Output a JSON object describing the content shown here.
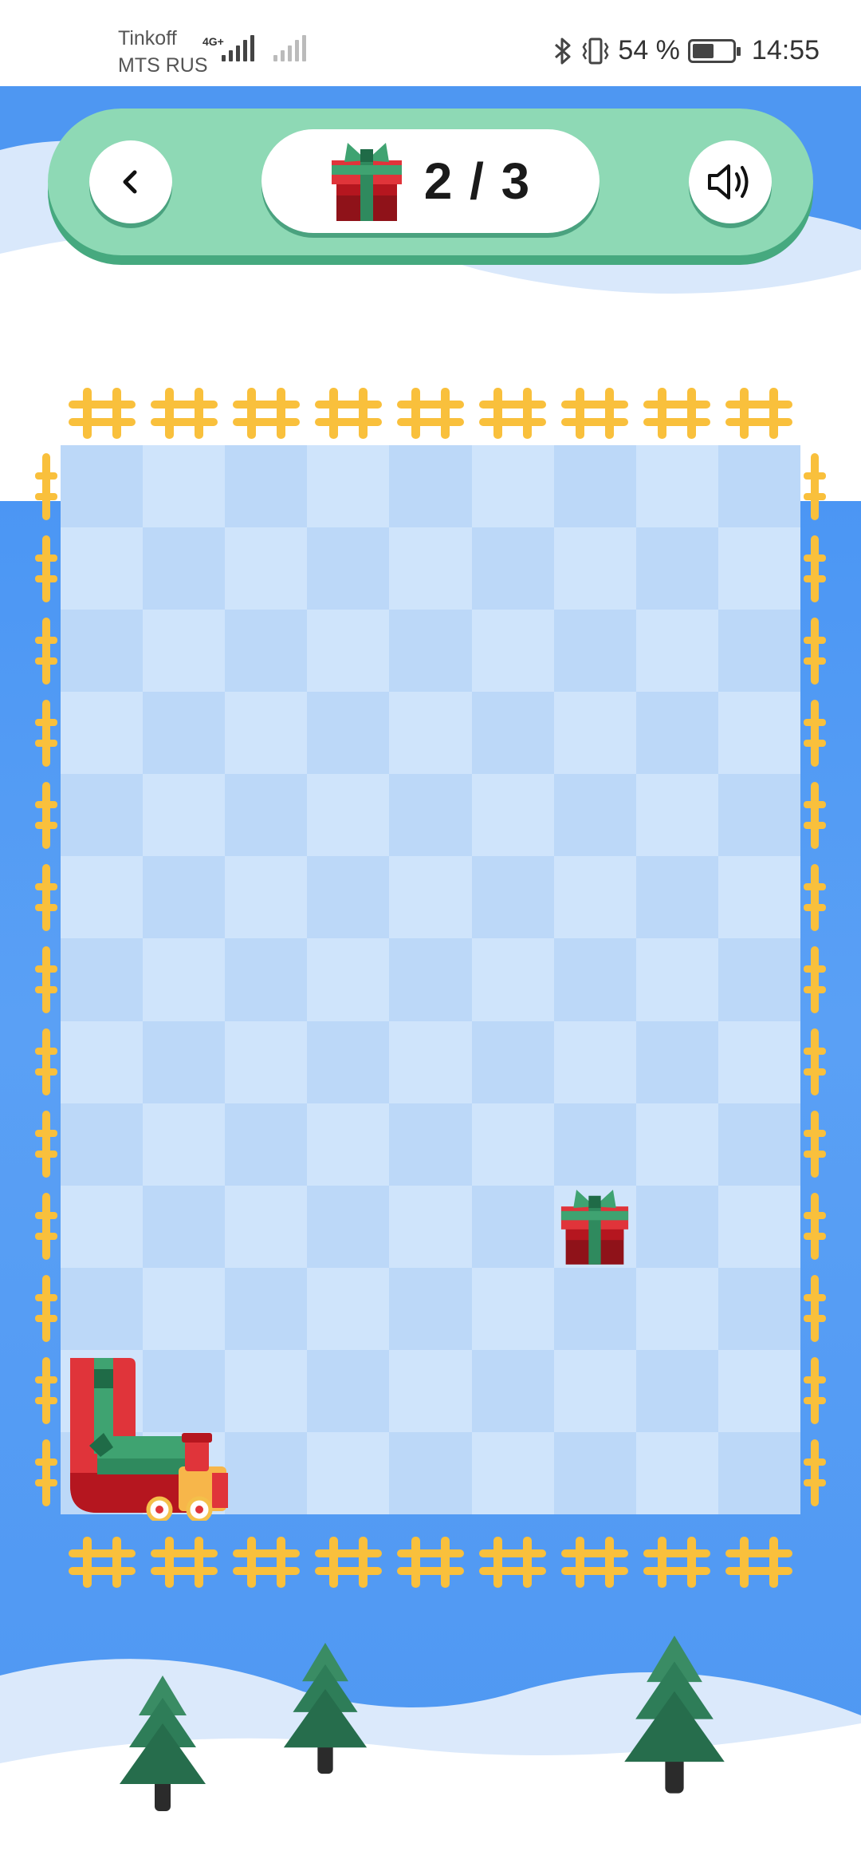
{
  "status_bar": {
    "carrier_1": "Tinkoff",
    "carrier_2": "MTS RUS",
    "network_type": "4G+",
    "battery_percent": "54 %",
    "battery_level": 0.54,
    "time": "14:55",
    "icons": [
      "bluetooth-icon",
      "vibrate-icon",
      "battery-icon"
    ]
  },
  "header": {
    "counter": "2 / 3",
    "counter_icon": "gift-icon",
    "back_icon": "chevron-left-icon",
    "sound_icon": "speaker-icon"
  },
  "board": {
    "columns": 9,
    "rows": 13,
    "gift_cell": {
      "col": 6,
      "row": 9
    },
    "train": {
      "head_cell": {
        "col": 1,
        "row": 12
      },
      "wagon_cells": [
        {
          "col": 0,
          "row": 11
        },
        {
          "col": 0,
          "row": 12
        }
      ]
    }
  },
  "colors": {
    "sky": "#4e97f2",
    "header_bg": "#8ed9b5",
    "header_shadow": "#46a97f",
    "cell_light": "#cfe4fb",
    "cell_dark": "#bcd8f8",
    "fence": "#f9c03c",
    "gift_red": "#c41f28",
    "ribbon_green": "#3b9a6d",
    "tree_green": "#2c7a58"
  }
}
